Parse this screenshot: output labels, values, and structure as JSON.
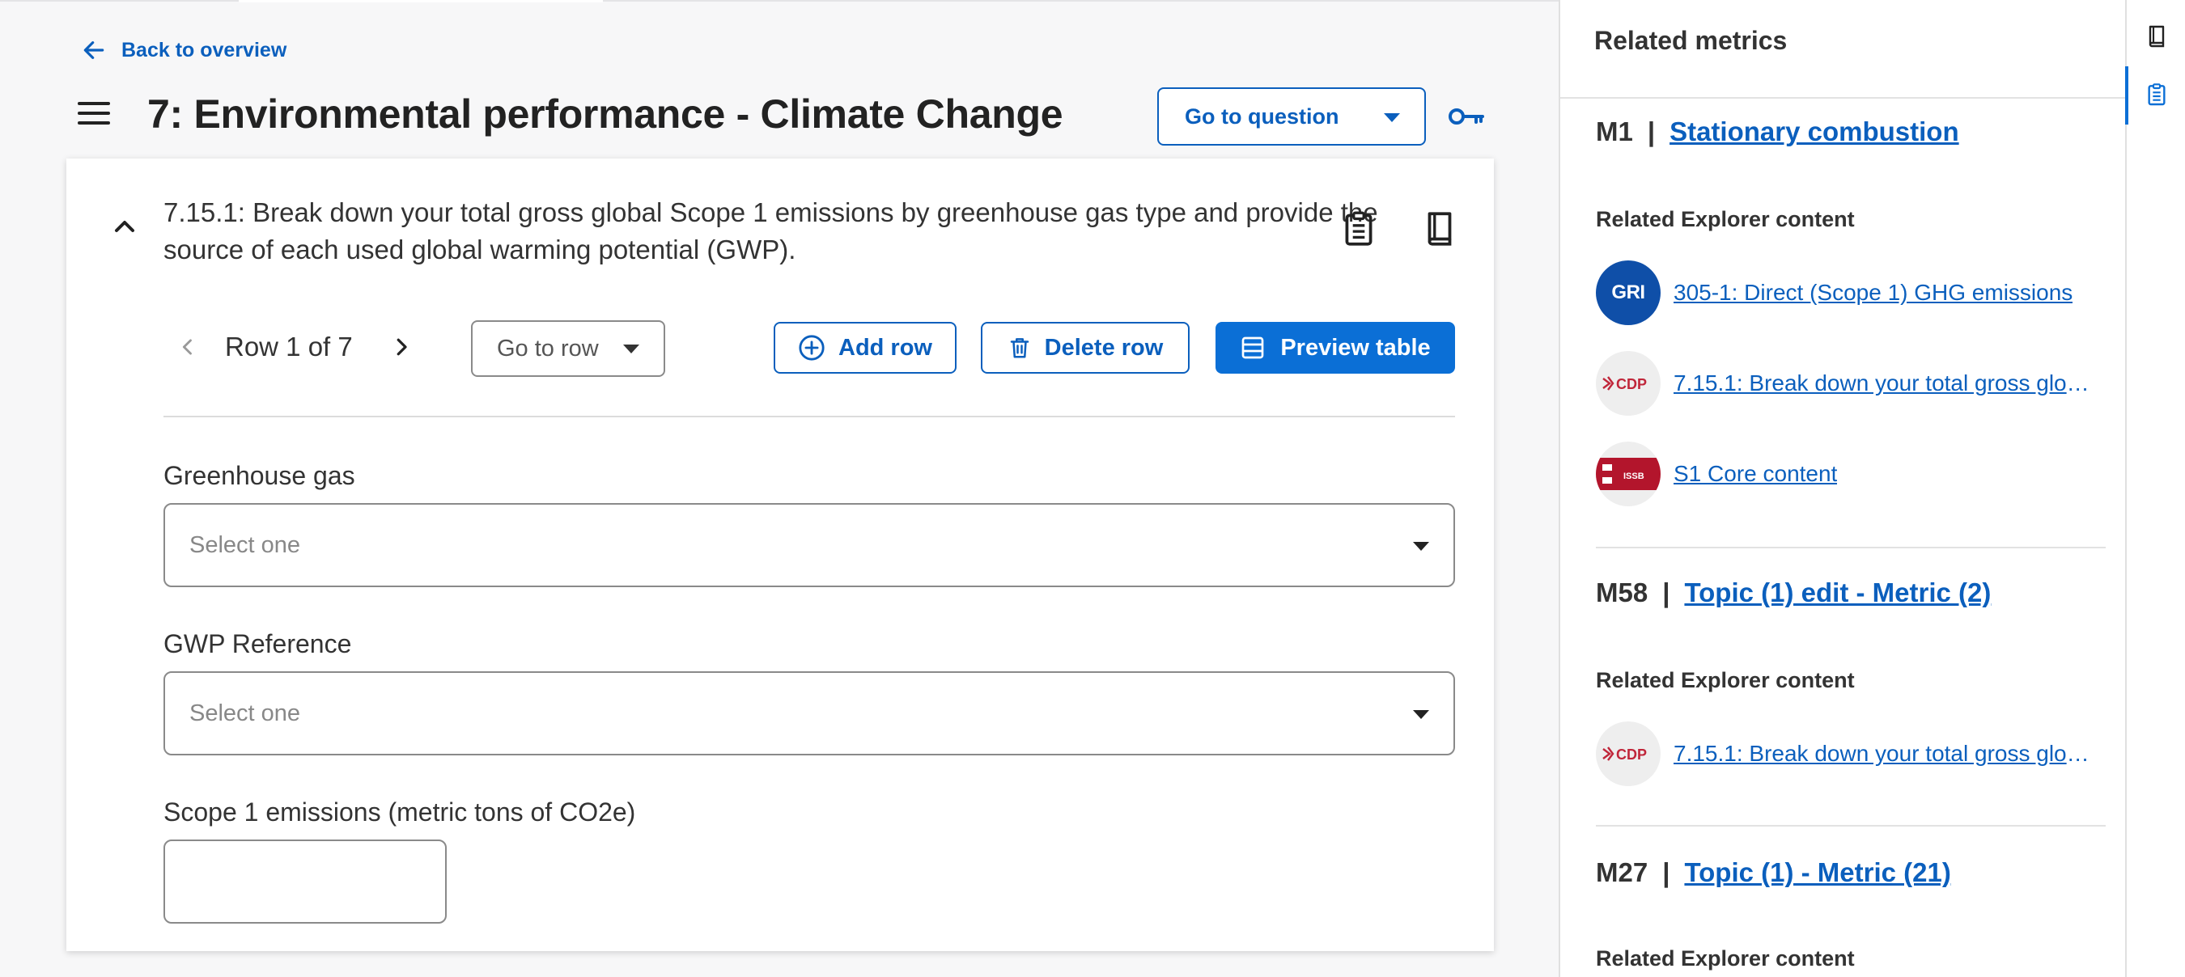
{
  "header": {
    "back_label": "Back to overview",
    "title": "7: Environmental performance - Climate Change",
    "goto_question_label": "Go to question"
  },
  "question": {
    "text": "7.15.1: Break down your total gross global Scope 1 emissions by greenhouse gas type and provide the source of each used global warming potential (GWP)."
  },
  "row_nav": {
    "label": "Row 1 of 7",
    "goto_row_label": "Go to row",
    "add_row_label": "Add row",
    "delete_row_label": "Delete row",
    "preview_table_label": "Preview table"
  },
  "fields": {
    "greenhouse_gas": {
      "label": "Greenhouse gas",
      "placeholder": "Select one"
    },
    "gwp_reference": {
      "label": "GWP Reference",
      "placeholder": "Select one"
    },
    "scope1": {
      "label": "Scope 1 emissions (metric tons of CO2e)",
      "value": ""
    }
  },
  "panel": {
    "title": "Related metrics",
    "metrics": [
      {
        "code": "M1",
        "sep": "|",
        "name": "Stationary combustion",
        "related_heading": "Related Explorer content",
        "items": [
          {
            "logo": "GRI",
            "logo_icon": "gri-logo",
            "text": "305-1: Direct (Scope 1) GHG emissions"
          },
          {
            "logo": "CDP",
            "logo_icon": "cdp-logo",
            "text": "7.15.1: Break down your total gross glob..."
          },
          {
            "logo": "ISSB",
            "logo_icon": "issb-logo",
            "text": "S1 Core content"
          }
        ]
      },
      {
        "code": "M58",
        "sep": "|",
        "name": "Topic (1) edit - Metric (2)",
        "related_heading": "Related Explorer content",
        "items": [
          {
            "logo": "CDP",
            "logo_icon": "cdp-logo",
            "text": "7.15.1: Break down your total gross glob..."
          }
        ]
      },
      {
        "code": "M27",
        "sep": "|",
        "name": "Topic (1) - Metric (21)",
        "related_heading": "Related Explorer content",
        "items": []
      }
    ]
  },
  "colors": {
    "accent": "#0b5fbd",
    "primary_button": "#0b6fd6",
    "gri": "#0f4fa8",
    "cdp": "#c0263a"
  }
}
